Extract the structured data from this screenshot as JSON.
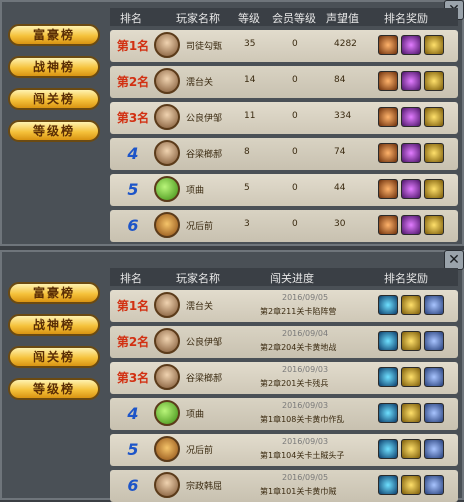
{
  "panel1": {
    "tabs": [
      "富豪榜",
      "战神榜",
      "闯关榜",
      "等级榜"
    ],
    "headers": [
      "排名",
      "玩家名称",
      "等级",
      "会员等级",
      "声望值",
      "排名奖励"
    ],
    "rows": [
      {
        "rank": "第1名",
        "name": "司徒勾甄",
        "level": "35",
        "vip": "0",
        "fame": "4282",
        "avatar": "face"
      },
      {
        "rank": "第2名",
        "name": "濡台关",
        "level": "14",
        "vip": "0",
        "fame": "84",
        "avatar": "face"
      },
      {
        "rank": "第3名",
        "name": "公良伊邹",
        "level": "11",
        "vip": "0",
        "fame": "334",
        "avatar": "face"
      },
      {
        "rank": "4",
        "name": "谷梁榔郝",
        "level": "8",
        "vip": "0",
        "fame": "74",
        "avatar": "face"
      },
      {
        "rank": "5",
        "name": "项曲",
        "level": "5",
        "vip": "0",
        "fame": "44",
        "avatar": "bean"
      },
      {
        "rank": "6",
        "name": "况后前",
        "level": "3",
        "vip": "0",
        "fame": "30",
        "avatar": "monkey"
      }
    ]
  },
  "panel2": {
    "tabs": [
      "富豪榜",
      "战神榜",
      "闯关榜",
      "等级榜"
    ],
    "headers": [
      "排名",
      "玩家名称",
      "闯关进度",
      "排名奖励"
    ],
    "rows": [
      {
        "rank": "第1名",
        "name": "濡台关",
        "date": "2016/09/05",
        "progress": "第2章211关卡陷阵营",
        "avatar": "face"
      },
      {
        "rank": "第2名",
        "name": "公良伊邹",
        "date": "2016/09/04",
        "progress": "第2章204关卡黄地战",
        "avatar": "face"
      },
      {
        "rank": "第3名",
        "name": "谷梁榔郝",
        "date": "2016/09/03",
        "progress": "第2章201关卡残兵",
        "avatar": "face"
      },
      {
        "rank": "4",
        "name": "项曲",
        "date": "2016/09/03",
        "progress": "第1章108关卡黄巾作乱",
        "avatar": "bean"
      },
      {
        "rank": "5",
        "name": "况后前",
        "date": "2016/09/03",
        "progress": "第1章104关卡土賊头子",
        "avatar": "monkey"
      },
      {
        "rank": "6",
        "name": "宗政韩屈",
        "date": "2016/09/05",
        "progress": "第1章101关卡黄巾贼",
        "avatar": "face"
      }
    ]
  },
  "close_glyph": "✕"
}
